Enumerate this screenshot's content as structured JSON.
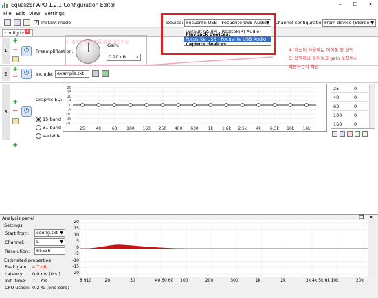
{
  "window": {
    "title": "Equalizer APO 1.2.1 Configuration Editor"
  },
  "menu": [
    "File",
    "Edit",
    "View",
    "Settings"
  ],
  "toolbar": {
    "instant_mode_label": "Instant mode",
    "instant_mode_checked": true
  },
  "device": {
    "label": "Device:",
    "selected": "Focusrite USB - Focusrite USB Audio",
    "dropdown": {
      "default_item": "Default (스피커 - Realtek(R) Audio)",
      "playback_header": "Playback devices:",
      "highlighted_item": "Focusrite USB - Focusrite USB Audio",
      "capture_header": "Capture devices:"
    }
  },
  "channel_config": {
    "label": "Channel configuration:",
    "value": "From device (Stereo)"
  },
  "tab": {
    "label": "config.txt"
  },
  "preamp": {
    "row": "1",
    "label": "Preamplification:",
    "gain_label": "Gain:",
    "gain_value": "0.20 dB"
  },
  "include": {
    "row": "2",
    "label": "Include:",
    "file": "example.txt"
  },
  "graphic_eq": {
    "row": "3",
    "label": "Graphic EQ:",
    "band_options": [
      "15-band",
      "31-band",
      "variable"
    ],
    "selected_band": "15-band",
    "y_ticks": [
      "20",
      "15",
      "10",
      "5",
      "0",
      "-5",
      "-10",
      "-15",
      "-20"
    ],
    "x_ticks": [
      "25",
      "40",
      "63",
      "100",
      "160",
      "250",
      "400",
      "630",
      "1k",
      "1.6k",
      "2.5k",
      "4k",
      "6.3k",
      "10k",
      "16k"
    ],
    "bands": [
      {
        "freq": "25",
        "gain": "0"
      },
      {
        "freq": "40",
        "gain": "0"
      },
      {
        "freq": "63",
        "gain": "0"
      },
      {
        "freq": "100",
        "gain": "0"
      },
      {
        "freq": "160",
        "gain": "0"
      }
    ]
  },
  "annotations": {
    "pink_note": "1. 유도? 최대 볼륨 위치 설정가능",
    "red_note_1": "4. 자신이 사용하는 이어폰 등 선택",
    "red_note_2": "5. 음악하나 틀어놓고 gain 움직여서",
    "red_note_3": "작동하는지 확인"
  },
  "analysis": {
    "title": "Analysis panel",
    "settings_label": "Settings",
    "start_from_label": "Start from:",
    "start_from_value": "config.txt",
    "channel_label": "Channel:",
    "channel_value": "L",
    "resolution_label": "Resolution:",
    "resolution_value": "65536",
    "estimated_label": "Estimated properties",
    "peak_gain_label": "Peak gain:",
    "peak_gain_value": "4.7 dB",
    "latency_label": "Latency:",
    "latency_value": "0.0 ms (0 s.)",
    "init_time_label": "Init. time:",
    "init_time_value": "7.1 ms",
    "cpu_label": "CPU usage:",
    "cpu_value": "0.2 % (one core)",
    "y_ticks": [
      "20",
      "15",
      "10",
      "5",
      "0",
      "-5",
      "-10",
      "-15",
      "-20"
    ],
    "x_ticks": [
      "8 910",
      "20",
      "30",
      "40 50 60",
      "100",
      "200",
      "300",
      "1k",
      "2k",
      "3k 4k 5k 6k",
      "10k",
      "20k"
    ]
  },
  "colors": {
    "accent_red": "#e02020",
    "pink": "#f3a4c4",
    "response_fill": "#cc1111"
  }
}
